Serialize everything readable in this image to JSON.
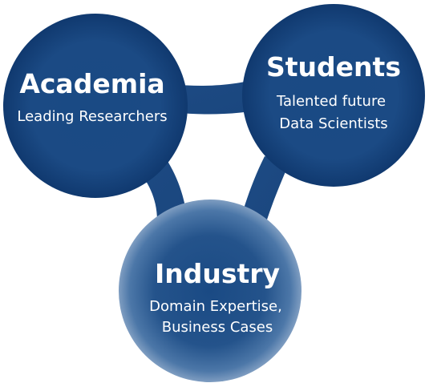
{
  "colors": {
    "fill_light": "#4a76a8",
    "fill_dark": "#123f78",
    "connector": "#1f4f87",
    "text": "#ffffff",
    "background": "#ffffff"
  },
  "nodes": {
    "academia": {
      "title": "Academia",
      "lines": [
        "Leading Researchers"
      ]
    },
    "students": {
      "title": "Students",
      "lines": [
        "Talented future",
        "Data Scientists"
      ]
    },
    "industry": {
      "title": "Industry",
      "lines": [
        "Domain Expertise,",
        "Business Cases"
      ]
    }
  }
}
